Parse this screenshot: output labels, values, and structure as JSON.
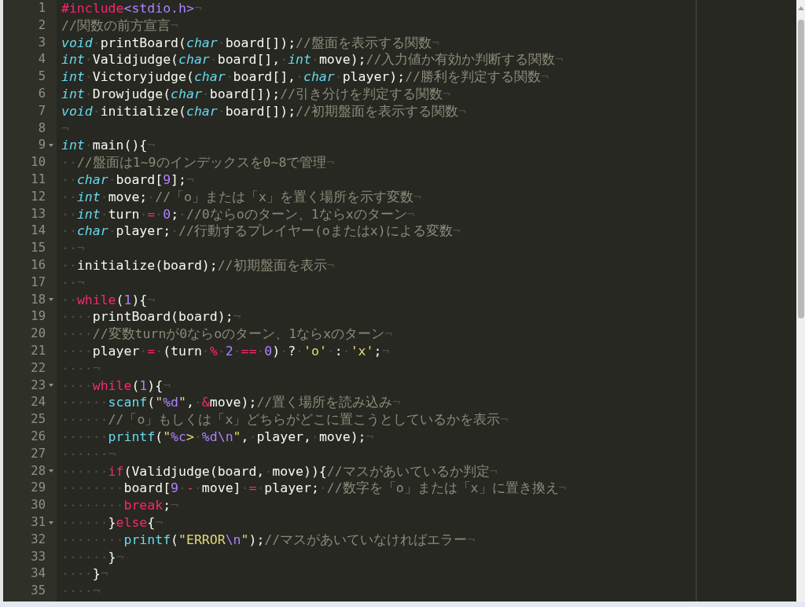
{
  "editor": {
    "lines": [
      {
        "number": "1",
        "fold": false,
        "tokens": [
          {
            "kind": "ctl",
            "text": "#include"
          },
          {
            "kind": "num",
            "text": "<stdio.h>"
          },
          {
            "kind": "ws",
            "text": "¬"
          }
        ]
      },
      {
        "number": "2",
        "fold": false,
        "tokens": [
          {
            "kind": "cm",
            "text": "//関数の前方宣言"
          },
          {
            "kind": "ws",
            "text": "¬"
          }
        ]
      },
      {
        "number": "3",
        "fold": false,
        "tokens": [
          {
            "kind": "kw",
            "text": "void"
          },
          {
            "kind": "ws",
            "text": "·"
          },
          {
            "kind": "tx",
            "text": "printBoard("
          },
          {
            "kind": "kw",
            "text": "char"
          },
          {
            "kind": "ws",
            "text": "·"
          },
          {
            "kind": "tx",
            "text": "board[]);"
          },
          {
            "kind": "cm",
            "text": "//盤面を表示する関数"
          },
          {
            "kind": "ws",
            "text": "¬"
          }
        ]
      },
      {
        "number": "4",
        "fold": false,
        "tokens": [
          {
            "kind": "kw",
            "text": "int"
          },
          {
            "kind": "ws",
            "text": "·"
          },
          {
            "kind": "tx",
            "text": "Validjudge("
          },
          {
            "kind": "kw",
            "text": "char"
          },
          {
            "kind": "ws",
            "text": "·"
          },
          {
            "kind": "tx",
            "text": "board[],"
          },
          {
            "kind": "ws",
            "text": "·"
          },
          {
            "kind": "kw",
            "text": "int"
          },
          {
            "kind": "ws",
            "text": "·"
          },
          {
            "kind": "tx",
            "text": "move);"
          },
          {
            "kind": "cm",
            "text": "//入力値か有効か判断する関数"
          },
          {
            "kind": "ws",
            "text": "¬"
          }
        ]
      },
      {
        "number": "5",
        "fold": false,
        "tokens": [
          {
            "kind": "kw",
            "text": "int"
          },
          {
            "kind": "ws",
            "text": "·"
          },
          {
            "kind": "tx",
            "text": "Victoryjudge("
          },
          {
            "kind": "kw",
            "text": "char"
          },
          {
            "kind": "ws",
            "text": "·"
          },
          {
            "kind": "tx",
            "text": "board[],"
          },
          {
            "kind": "ws",
            "text": "·"
          },
          {
            "kind": "kw",
            "text": "char"
          },
          {
            "kind": "ws",
            "text": "·"
          },
          {
            "kind": "tx",
            "text": "player);"
          },
          {
            "kind": "cm",
            "text": "//勝利を判定する関数"
          },
          {
            "kind": "ws",
            "text": "¬"
          }
        ]
      },
      {
        "number": "6",
        "fold": false,
        "tokens": [
          {
            "kind": "kw",
            "text": "int"
          },
          {
            "kind": "ws",
            "text": "·"
          },
          {
            "kind": "tx",
            "text": "Drowjudge("
          },
          {
            "kind": "kw",
            "text": "char"
          },
          {
            "kind": "ws",
            "text": "·"
          },
          {
            "kind": "tx",
            "text": "board[]);"
          },
          {
            "kind": "cm",
            "text": "//引き分けを判定する関数"
          },
          {
            "kind": "ws",
            "text": "¬"
          }
        ]
      },
      {
        "number": "7",
        "fold": false,
        "tokens": [
          {
            "kind": "kw",
            "text": "void"
          },
          {
            "kind": "ws",
            "text": "·"
          },
          {
            "kind": "tx",
            "text": "initialize("
          },
          {
            "kind": "kw",
            "text": "char"
          },
          {
            "kind": "ws",
            "text": "·"
          },
          {
            "kind": "tx",
            "text": "board[]);"
          },
          {
            "kind": "cm",
            "text": "//初期盤面を表示する関数"
          },
          {
            "kind": "ws",
            "text": "¬"
          }
        ]
      },
      {
        "number": "8",
        "fold": false,
        "tokens": [
          {
            "kind": "ws",
            "text": "¬"
          }
        ]
      },
      {
        "number": "9",
        "fold": true,
        "tokens": [
          {
            "kind": "kw",
            "text": "int"
          },
          {
            "kind": "ws",
            "text": "·"
          },
          {
            "kind": "tx",
            "text": "main(){"
          },
          {
            "kind": "ws",
            "text": "¬"
          }
        ]
      },
      {
        "number": "10",
        "fold": false,
        "tokens": [
          {
            "kind": "ws",
            "text": "··"
          },
          {
            "kind": "cm",
            "text": "//盤面は1~9のインデックスを0~8で管理"
          },
          {
            "kind": "ws",
            "text": "¬"
          }
        ]
      },
      {
        "number": "11",
        "fold": false,
        "tokens": [
          {
            "kind": "ws",
            "text": "··"
          },
          {
            "kind": "kw",
            "text": "char"
          },
          {
            "kind": "ws",
            "text": "·"
          },
          {
            "kind": "tx",
            "text": "board["
          },
          {
            "kind": "num",
            "text": "9"
          },
          {
            "kind": "tx",
            "text": "];"
          },
          {
            "kind": "ws",
            "text": "¬"
          }
        ]
      },
      {
        "number": "12",
        "fold": false,
        "tokens": [
          {
            "kind": "ws",
            "text": "··"
          },
          {
            "kind": "kw",
            "text": "int"
          },
          {
            "kind": "ws",
            "text": "·"
          },
          {
            "kind": "tx",
            "text": "move;"
          },
          {
            "kind": "ws",
            "text": "·"
          },
          {
            "kind": "cm",
            "text": "//「o」または「x」を置く場所を示す変数"
          },
          {
            "kind": "ws",
            "text": "¬"
          }
        ]
      },
      {
        "number": "13",
        "fold": false,
        "tokens": [
          {
            "kind": "ws",
            "text": "··"
          },
          {
            "kind": "kw",
            "text": "int"
          },
          {
            "kind": "ws",
            "text": "·"
          },
          {
            "kind": "tx",
            "text": "turn"
          },
          {
            "kind": "ws",
            "text": "·"
          },
          {
            "kind": "op",
            "text": "="
          },
          {
            "kind": "ws",
            "text": "·"
          },
          {
            "kind": "num",
            "text": "0"
          },
          {
            "kind": "tx",
            "text": ";"
          },
          {
            "kind": "ws",
            "text": "·"
          },
          {
            "kind": "cm",
            "text": "//0ならoのターン、1ならxのターン"
          },
          {
            "kind": "ws",
            "text": "¬"
          }
        ]
      },
      {
        "number": "14",
        "fold": false,
        "tokens": [
          {
            "kind": "ws",
            "text": "··"
          },
          {
            "kind": "kw",
            "text": "char"
          },
          {
            "kind": "ws",
            "text": "·"
          },
          {
            "kind": "tx",
            "text": "player;"
          },
          {
            "kind": "ws",
            "text": "·"
          },
          {
            "kind": "cm",
            "text": "//行動するプレイヤー(oまたはx)による変数"
          },
          {
            "kind": "ws",
            "text": "¬"
          }
        ]
      },
      {
        "number": "15",
        "fold": false,
        "tokens": [
          {
            "kind": "ws",
            "text": "··¬"
          }
        ]
      },
      {
        "number": "16",
        "fold": false,
        "tokens": [
          {
            "kind": "ws",
            "text": "··"
          },
          {
            "kind": "tx",
            "text": "initialize(board);"
          },
          {
            "kind": "cm",
            "text": "//初期盤面を表示"
          },
          {
            "kind": "ws",
            "text": "¬"
          }
        ]
      },
      {
        "number": "17",
        "fold": false,
        "tokens": [
          {
            "kind": "ws",
            "text": "··¬"
          }
        ]
      },
      {
        "number": "18",
        "fold": true,
        "tokens": [
          {
            "kind": "ws",
            "text": "··"
          },
          {
            "kind": "ctl",
            "text": "while"
          },
          {
            "kind": "tx",
            "text": "("
          },
          {
            "kind": "num",
            "text": "1"
          },
          {
            "kind": "tx",
            "text": "){"
          },
          {
            "kind": "ws",
            "text": "¬"
          }
        ]
      },
      {
        "number": "19",
        "fold": false,
        "tokens": [
          {
            "kind": "ws",
            "text": "····"
          },
          {
            "kind": "tx",
            "text": "printBoard(board);"
          },
          {
            "kind": "ws",
            "text": "¬"
          }
        ]
      },
      {
        "number": "20",
        "fold": false,
        "tokens": [
          {
            "kind": "ws",
            "text": "····"
          },
          {
            "kind": "cm",
            "text": "//変数turnが0ならoのターン、1ならxのターン"
          },
          {
            "kind": "ws",
            "text": "¬"
          }
        ]
      },
      {
        "number": "21",
        "fold": false,
        "tokens": [
          {
            "kind": "ws",
            "text": "····"
          },
          {
            "kind": "tx",
            "text": "player"
          },
          {
            "kind": "ws",
            "text": "·"
          },
          {
            "kind": "op",
            "text": "="
          },
          {
            "kind": "ws",
            "text": "·"
          },
          {
            "kind": "tx",
            "text": "(turn"
          },
          {
            "kind": "ws",
            "text": "·"
          },
          {
            "kind": "op",
            "text": "%"
          },
          {
            "kind": "ws",
            "text": "·"
          },
          {
            "kind": "num",
            "text": "2"
          },
          {
            "kind": "ws",
            "text": "·"
          },
          {
            "kind": "op",
            "text": "=="
          },
          {
            "kind": "ws",
            "text": "·"
          },
          {
            "kind": "num",
            "text": "0"
          },
          {
            "kind": "tx",
            "text": ")"
          },
          {
            "kind": "ws",
            "text": "·"
          },
          {
            "kind": "tx",
            "text": "?"
          },
          {
            "kind": "ws",
            "text": "·"
          },
          {
            "kind": "str",
            "text": "'o'"
          },
          {
            "kind": "ws",
            "text": "·"
          },
          {
            "kind": "tx",
            "text": ":"
          },
          {
            "kind": "ws",
            "text": "·"
          },
          {
            "kind": "str",
            "text": "'x'"
          },
          {
            "kind": "tx",
            "text": ";"
          },
          {
            "kind": "ws",
            "text": "¬"
          }
        ]
      },
      {
        "number": "22",
        "fold": false,
        "tokens": [
          {
            "kind": "ws",
            "text": "····¬"
          }
        ]
      },
      {
        "number": "23",
        "fold": true,
        "tokens": [
          {
            "kind": "ws",
            "text": "····"
          },
          {
            "kind": "ctl",
            "text": "while"
          },
          {
            "kind": "tx",
            "text": "("
          },
          {
            "kind": "num",
            "text": "1"
          },
          {
            "kind": "tx",
            "text": "){"
          },
          {
            "kind": "ws",
            "text": "¬"
          }
        ]
      },
      {
        "number": "24",
        "fold": false,
        "tokens": [
          {
            "kind": "ws",
            "text": "······"
          },
          {
            "kind": "fn",
            "text": "scanf"
          },
          {
            "kind": "tx",
            "text": "("
          },
          {
            "kind": "str",
            "text": "\""
          },
          {
            "kind": "num",
            "text": "%d"
          },
          {
            "kind": "str",
            "text": "\""
          },
          {
            "kind": "tx",
            "text": ","
          },
          {
            "kind": "ws",
            "text": "·"
          },
          {
            "kind": "op",
            "text": "&"
          },
          {
            "kind": "tx",
            "text": "move);"
          },
          {
            "kind": "cm",
            "text": "//置く場所を読み込み"
          },
          {
            "kind": "ws",
            "text": "¬"
          }
        ]
      },
      {
        "number": "25",
        "fold": false,
        "tokens": [
          {
            "kind": "ws",
            "text": "······"
          },
          {
            "kind": "cm",
            "text": "//「o」もしくは「x」どちらがどこに置こうとしているかを表示"
          },
          {
            "kind": "ws",
            "text": "¬"
          }
        ]
      },
      {
        "number": "26",
        "fold": false,
        "tokens": [
          {
            "kind": "ws",
            "text": "······"
          },
          {
            "kind": "fn",
            "text": "printf"
          },
          {
            "kind": "tx",
            "text": "("
          },
          {
            "kind": "str",
            "text": "\""
          },
          {
            "kind": "num",
            "text": "%c"
          },
          {
            "kind": "str",
            "text": ">"
          },
          {
            "kind": "ws",
            "text": "·"
          },
          {
            "kind": "num",
            "text": "%d\\n"
          },
          {
            "kind": "str",
            "text": "\""
          },
          {
            "kind": "tx",
            "text": ","
          },
          {
            "kind": "ws",
            "text": "·"
          },
          {
            "kind": "tx",
            "text": "player,"
          },
          {
            "kind": "ws",
            "text": "·"
          },
          {
            "kind": "tx",
            "text": "move);"
          },
          {
            "kind": "ws",
            "text": "¬"
          }
        ]
      },
      {
        "number": "27",
        "fold": false,
        "tokens": [
          {
            "kind": "ws",
            "text": "······¬"
          }
        ]
      },
      {
        "number": "28",
        "fold": true,
        "tokens": [
          {
            "kind": "ws",
            "text": "······"
          },
          {
            "kind": "ctl",
            "text": "if"
          },
          {
            "kind": "tx",
            "text": "(Validjudge(board,"
          },
          {
            "kind": "ws",
            "text": "·"
          },
          {
            "kind": "tx",
            "text": "move)){"
          },
          {
            "kind": "cm",
            "text": "//マスがあいているか判定"
          },
          {
            "kind": "ws",
            "text": "¬"
          }
        ]
      },
      {
        "number": "29",
        "fold": false,
        "tokens": [
          {
            "kind": "ws",
            "text": "········"
          },
          {
            "kind": "tx",
            "text": "board["
          },
          {
            "kind": "num",
            "text": "9"
          },
          {
            "kind": "ws",
            "text": "·"
          },
          {
            "kind": "op",
            "text": "-"
          },
          {
            "kind": "ws",
            "text": "·"
          },
          {
            "kind": "tx",
            "text": "move]"
          },
          {
            "kind": "ws",
            "text": "·"
          },
          {
            "kind": "op",
            "text": "="
          },
          {
            "kind": "ws",
            "text": "·"
          },
          {
            "kind": "tx",
            "text": "player;"
          },
          {
            "kind": "ws",
            "text": "·"
          },
          {
            "kind": "cm",
            "text": "//数字を「o」または「x」に置き換え"
          },
          {
            "kind": "ws",
            "text": "¬"
          }
        ]
      },
      {
        "number": "30",
        "fold": false,
        "tokens": [
          {
            "kind": "ws",
            "text": "········"
          },
          {
            "kind": "ctl",
            "text": "break"
          },
          {
            "kind": "tx",
            "text": ";"
          },
          {
            "kind": "ws",
            "text": "¬"
          }
        ]
      },
      {
        "number": "31",
        "fold": true,
        "tokens": [
          {
            "kind": "ws",
            "text": "······"
          },
          {
            "kind": "tx",
            "text": "}"
          },
          {
            "kind": "ctl",
            "text": "else"
          },
          {
            "kind": "tx",
            "text": "{"
          },
          {
            "kind": "ws",
            "text": "¬"
          }
        ]
      },
      {
        "number": "32",
        "fold": false,
        "tokens": [
          {
            "kind": "ws",
            "text": "········"
          },
          {
            "kind": "fn",
            "text": "printf"
          },
          {
            "kind": "tx",
            "text": "("
          },
          {
            "kind": "str",
            "text": "\"ERROR"
          },
          {
            "kind": "num",
            "text": "\\n"
          },
          {
            "kind": "str",
            "text": "\""
          },
          {
            "kind": "tx",
            "text": ");"
          },
          {
            "kind": "cm",
            "text": "//マスがあいていなければエラー"
          },
          {
            "kind": "ws",
            "text": "¬"
          }
        ]
      },
      {
        "number": "33",
        "fold": false,
        "tokens": [
          {
            "kind": "ws",
            "text": "······"
          },
          {
            "kind": "tx",
            "text": "}"
          },
          {
            "kind": "ws",
            "text": "¬"
          }
        ]
      },
      {
        "number": "34",
        "fold": false,
        "tokens": [
          {
            "kind": "ws",
            "text": "····"
          },
          {
            "kind": "tx",
            "text": "}"
          },
          {
            "kind": "ws",
            "text": "¬"
          }
        ]
      },
      {
        "number": "35",
        "fold": false,
        "tokens": [
          {
            "kind": "ws",
            "text": "····¬"
          }
        ]
      }
    ]
  }
}
